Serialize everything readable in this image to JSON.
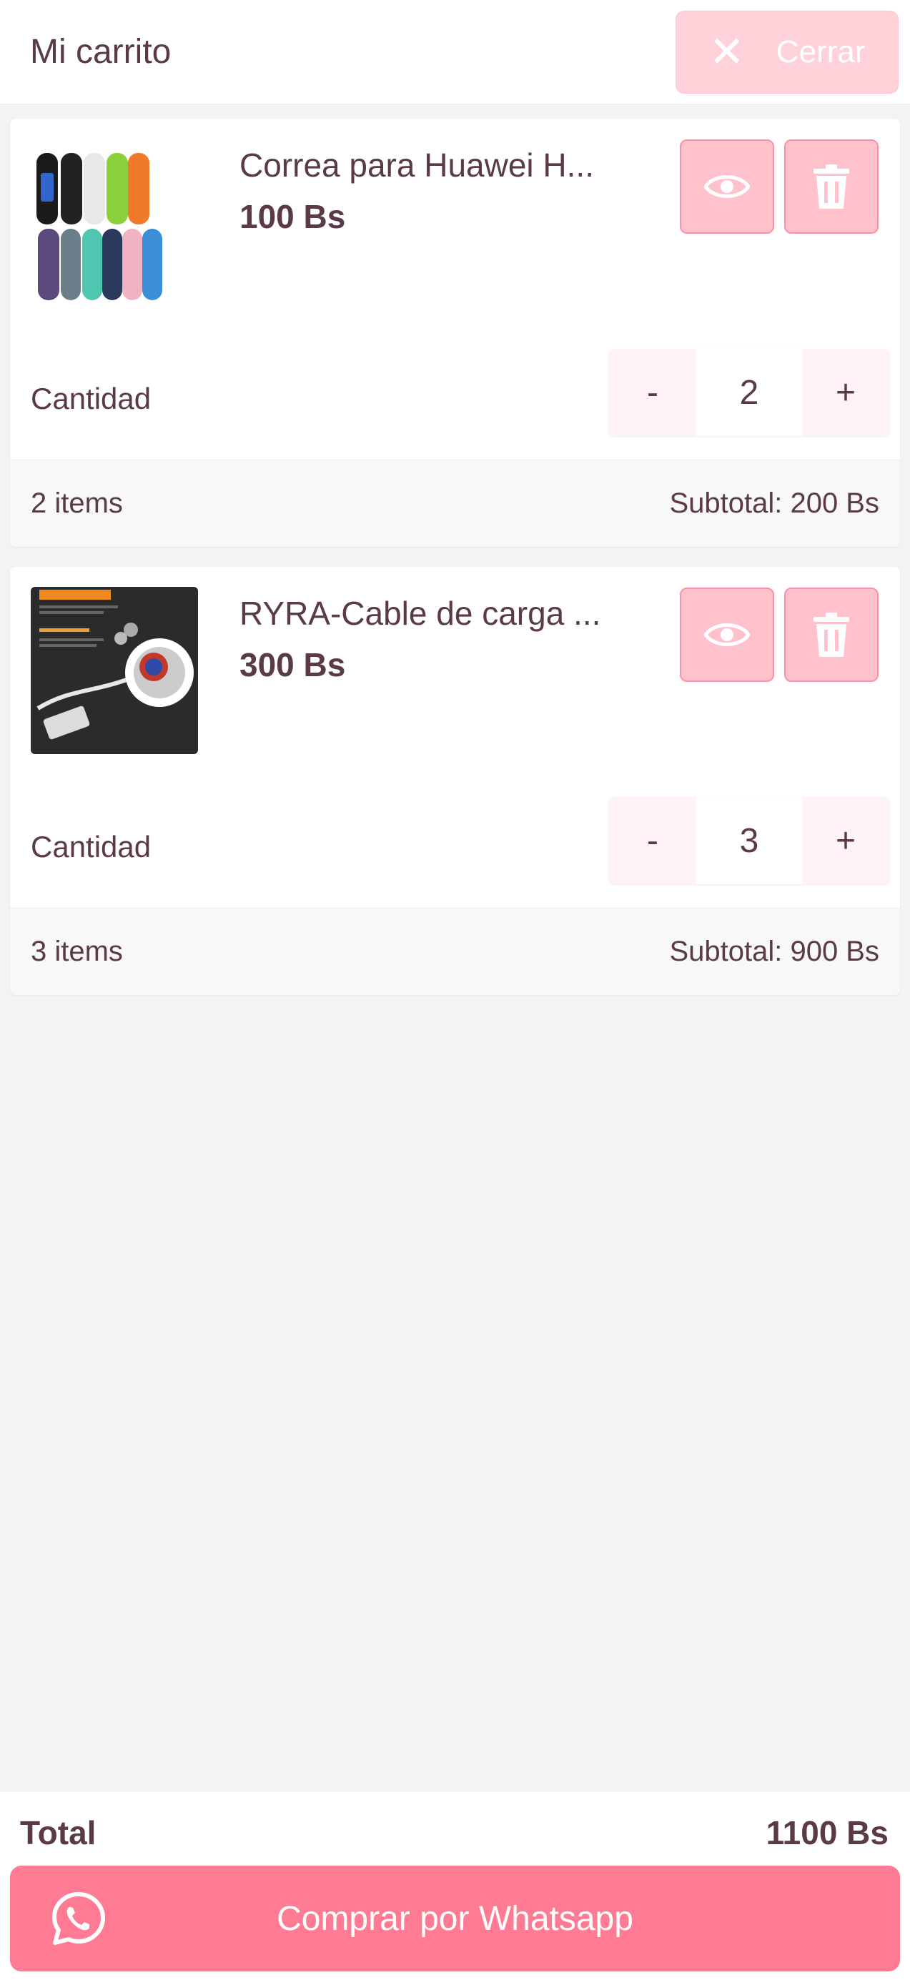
{
  "header": {
    "title": "Mi carrito",
    "close_label": "Cerrar"
  },
  "items": [
    {
      "name": "Correa para Huawei H...",
      "price": "100 Bs",
      "quantity_label": "Cantidad",
      "quantity": "2",
      "decrement": "-",
      "increment": "+",
      "items_count": "2 items",
      "subtotal": "Subtotal: 200 Bs"
    },
    {
      "name": "RYRA-Cable de carga ...",
      "price": "300 Bs",
      "quantity_label": "Cantidad",
      "quantity": "3",
      "decrement": "-",
      "increment": "+",
      "items_count": "3 items",
      "subtotal": "Subtotal: 900 Bs"
    }
  ],
  "footer": {
    "total_label": "Total",
    "total_value": "1100 Bs",
    "buy_label": "Comprar por Whatsapp"
  },
  "colors": {
    "accent": "#ff7b94",
    "accent_light": "#ffc1cc",
    "text": "#5a3a48"
  }
}
